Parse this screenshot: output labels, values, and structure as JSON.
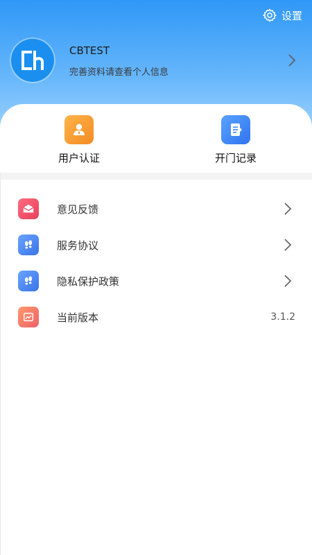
{
  "header": {
    "settings_label": "设置",
    "settings_icon": "gear-icon",
    "gradient_top": "#2f98f7",
    "gradient_bottom": "#a4d5fd"
  },
  "profile": {
    "avatar_text": "Cb",
    "name": "CBTEST",
    "subtitle": "完善资料请查看个人信息"
  },
  "quick_actions": [
    {
      "label": "用户认证",
      "icon": "user-badge-icon",
      "color": "#f59c33"
    },
    {
      "label": "开门记录",
      "icon": "document-icon",
      "color": "#3a86f5"
    }
  ],
  "menu": [
    {
      "label": "意见反馈",
      "icon": "envelope-icon",
      "color": "#ef4f68",
      "chevron": true
    },
    {
      "label": "服务协议",
      "icon": "footprints-icon",
      "color": "#4b87f2",
      "chevron": true
    },
    {
      "label": "隐私保护政策",
      "icon": "footprints-icon",
      "color": "#4b87f2",
      "chevron": true
    },
    {
      "label": "当前版本",
      "icon": "chart-icon",
      "color": "#f47a66",
      "value": "3.1.2",
      "chevron": false
    }
  ]
}
